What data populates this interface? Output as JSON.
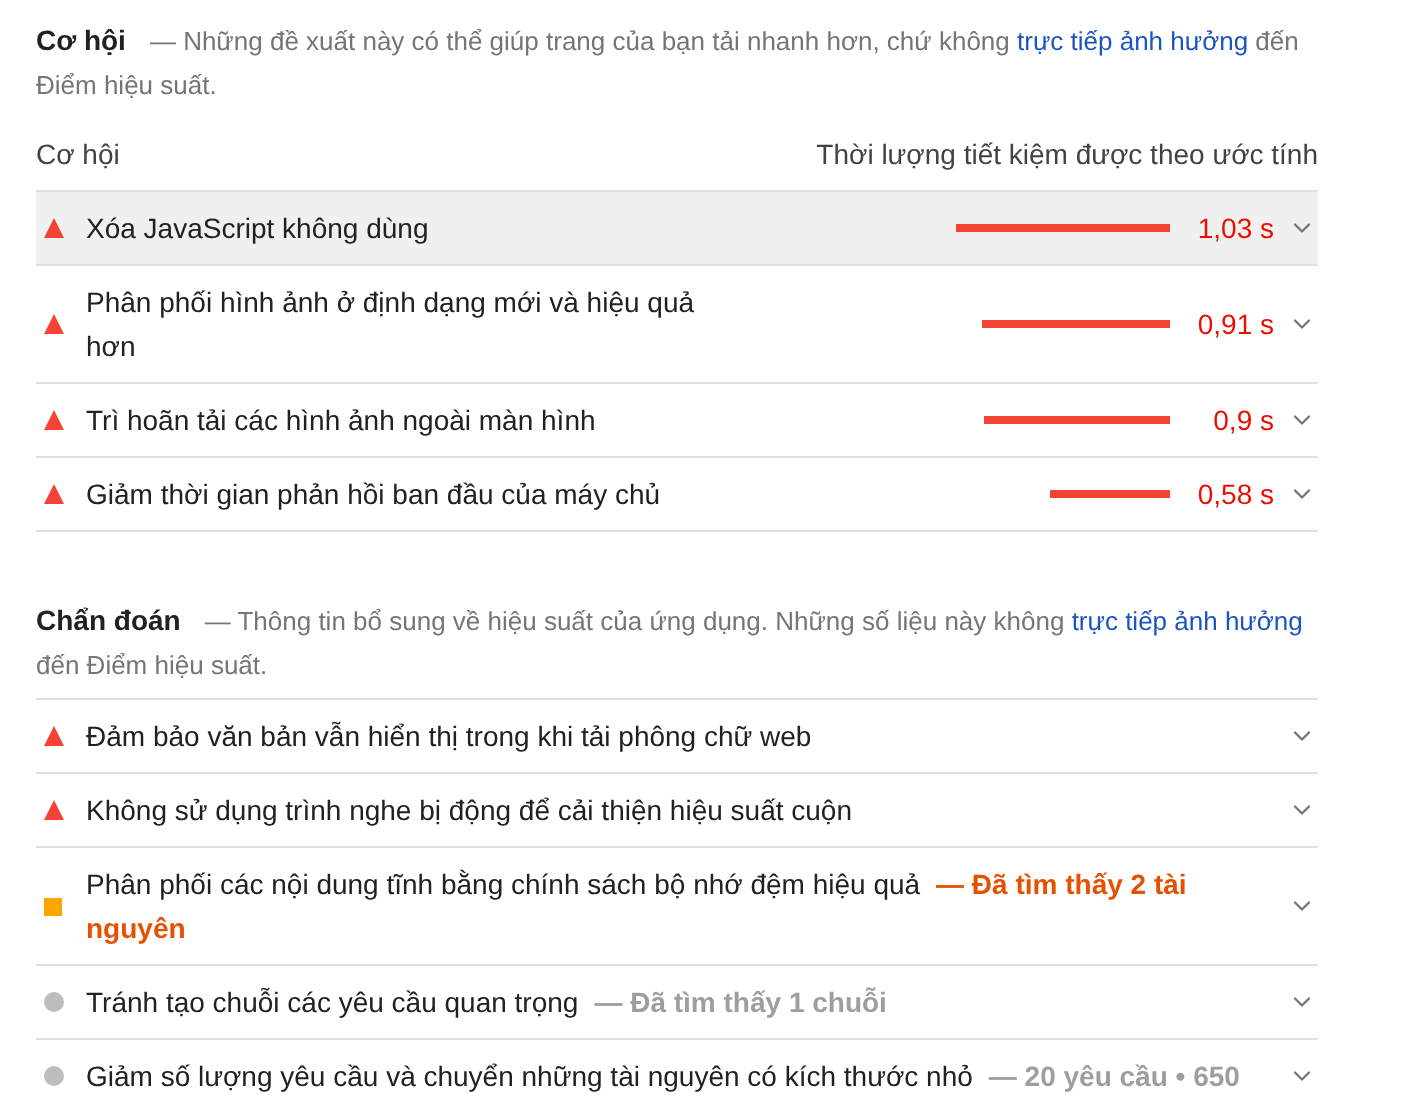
{
  "opportunities": {
    "title": "Cơ hội",
    "description": "— Những đề xuất này có thể giúp trang của bạn tải nhanh hơn, chứ không ",
    "link": "trực tiếp ảnh hưởng",
    "description_end": " đến Điểm hiệu suất.",
    "column_1": "Cơ hội",
    "column_2": "Thời lượng tiết kiệm được theo ước tính",
    "items": [
      {
        "title": "Xóa JavaScript không dùng",
        "savings": "1,03 s",
        "highlighted": true,
        "kind": "fail"
      },
      {
        "title": "Phân phối hình ảnh ở định dạng mới và hiệu quả hơn",
        "savings": "0,91 s",
        "highlighted": false,
        "kind": "fail"
      },
      {
        "title": "Trì hoãn tải các hình ảnh ngoài màn hình",
        "savings": "0,9 s",
        "highlighted": false,
        "kind": "fail"
      },
      {
        "title": "Giảm thời gian phản hồi ban đầu của máy chủ",
        "savings": "0,58 s",
        "highlighted": false,
        "kind": "fail"
      }
    ]
  },
  "diagnostics": {
    "title": "Chẩn đoán",
    "description": "— Thông tin bổ sung về hiệu suất của ứng dụng. Những số liệu này không ",
    "link": "trực tiếp ảnh hưởng",
    "description_end": " đến Điểm hiệu suất.",
    "items": [
      {
        "title": "Đảm bảo văn bản vẫn hiển thị trong khi tải phông chữ web",
        "kind": "fail"
      },
      {
        "title": "Không sử dụng trình nghe bị động để cải thiện hiệu suất cuộn",
        "kind": "fail"
      },
      {
        "title": "Phân phối các nội dung tĩnh bằng chính sách bộ nhớ đệm hiệu quả",
        "detail": "— Đã tìm thấy 2 tài nguyên",
        "kind": "average"
      },
      {
        "title": "Tránh tạo chuỗi các yêu cầu quan trọng",
        "detail": "— Đã tìm thấy 1 chuỗi",
        "kind": "info"
      },
      {
        "title": "Giảm số lượng yêu cầu và chuyển những tài nguyên có kích thước nhỏ",
        "detail": "— 20 yêu cầu • 650",
        "kind": "info"
      }
    ]
  }
}
